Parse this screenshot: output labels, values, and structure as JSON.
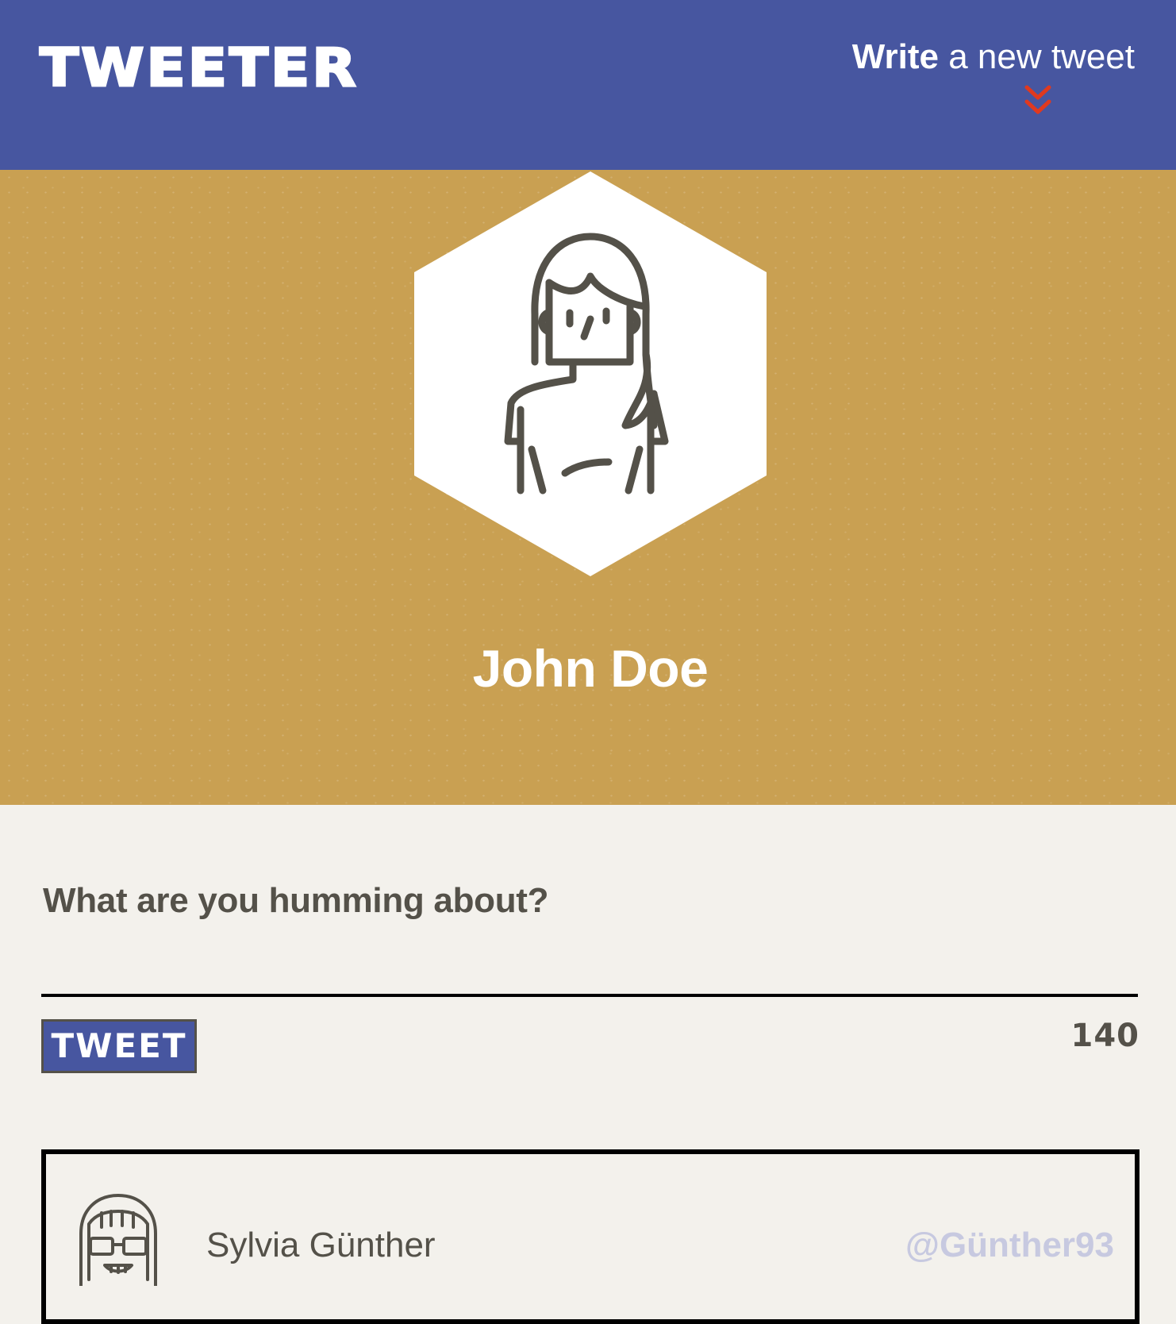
{
  "nav": {
    "logo": "TWEETER",
    "compose_toggle": {
      "strong": "Write",
      "rest": " a new tweet"
    },
    "chevron_icon": "double-chevron-down-icon",
    "chevron_color": "#e0391f"
  },
  "profile": {
    "name": "John Doe",
    "avatar_icon": "woman-avatar-icon"
  },
  "compose": {
    "label": "What are you humming about?",
    "input_value": "",
    "button_label": "TWEET",
    "char_count": "140"
  },
  "tweets": [
    {
      "author": "Sylvia Günther",
      "handle": "@Günther93",
      "avatar_icon": "girl-with-glasses-avatar-icon"
    }
  ],
  "colors": {
    "nav_bg": "#4756a0",
    "banner_bg": "#c9a052",
    "page_bg": "#f3f1ec",
    "text": "#545149",
    "handle": "#c7c9e0",
    "accent": "#e0391f"
  }
}
